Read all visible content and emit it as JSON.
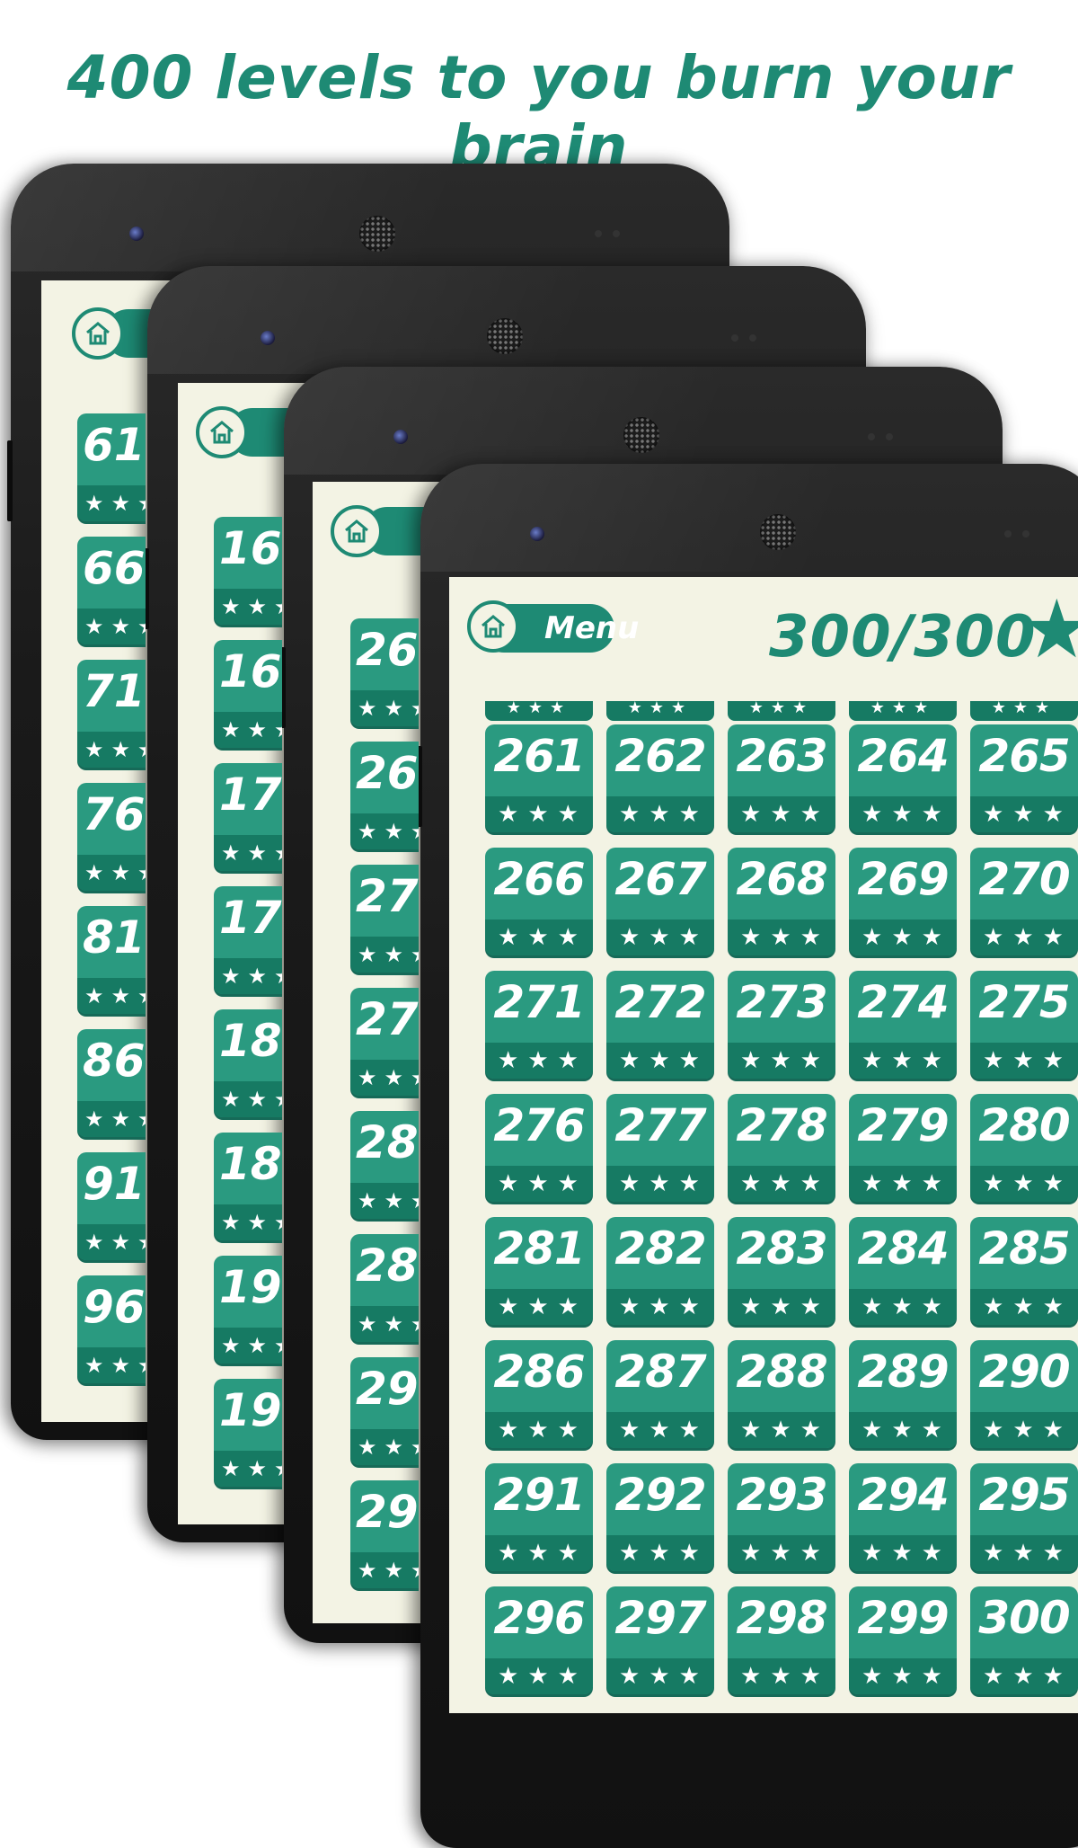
{
  "headline": "400 levels to you burn your brain",
  "menu_label": "Menu",
  "score": "300/300",
  "icons": {
    "home": "home-icon",
    "star": "star-icon"
  },
  "colors": {
    "accent": "#1e8a74",
    "tile": "#2a9a80",
    "tile_dark": "#167a63",
    "screen_bg": "#f3f3e4"
  },
  "star_glyphs": "★★★",
  "phone1_levels": [
    "61",
    "66",
    "71",
    "76",
    "81",
    "86",
    "91",
    "96"
  ],
  "phone2_levels": [
    "16",
    "16",
    "17",
    "17",
    "18",
    "18",
    "19",
    "19"
  ],
  "phone3_levels": [
    "26",
    "26",
    "27",
    "27",
    "28",
    "28",
    "29",
    "29"
  ],
  "levels": [
    [
      "261",
      "262",
      "263",
      "264",
      "265"
    ],
    [
      "266",
      "267",
      "268",
      "269",
      "270"
    ],
    [
      "271",
      "272",
      "273",
      "274",
      "275"
    ],
    [
      "276",
      "277",
      "278",
      "279",
      "280"
    ],
    [
      "281",
      "282",
      "283",
      "284",
      "285"
    ],
    [
      "286",
      "287",
      "288",
      "289",
      "290"
    ],
    [
      "291",
      "292",
      "293",
      "294",
      "295"
    ],
    [
      "296",
      "297",
      "298",
      "299",
      "300"
    ]
  ]
}
